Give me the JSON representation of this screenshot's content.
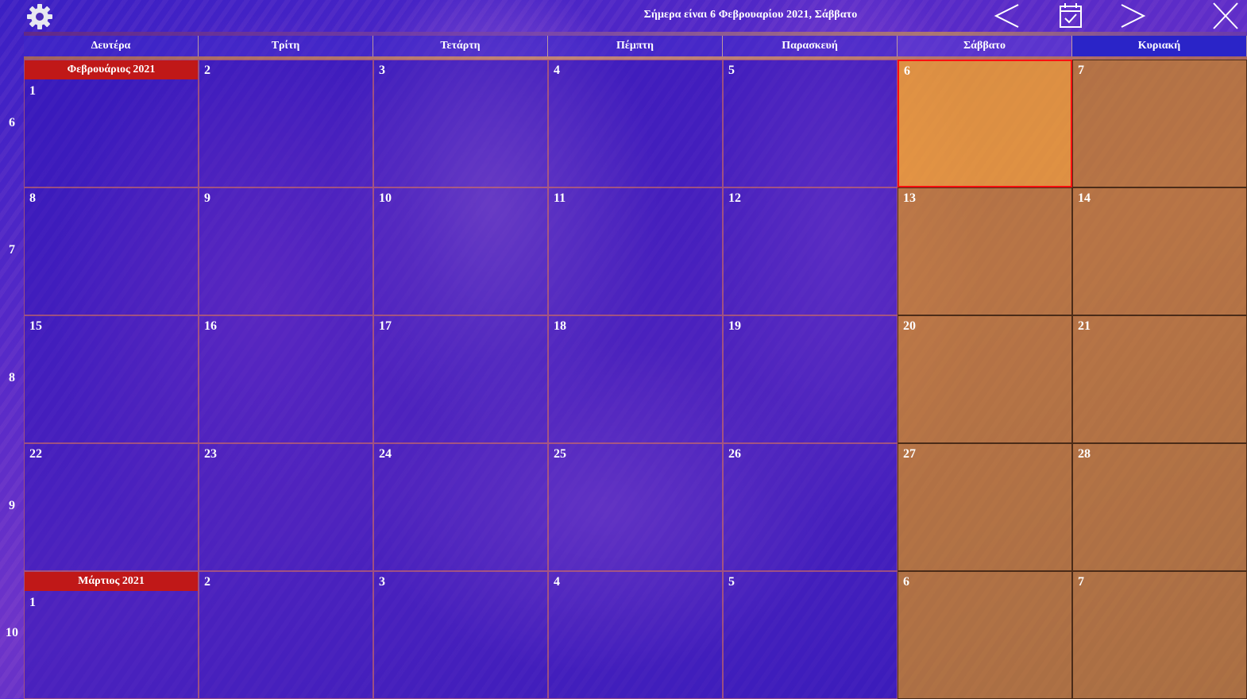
{
  "header": {
    "title": "Σήμερα είναι 6 Φεβρουαρίου 2021, Σάββατο"
  },
  "toolbar": {
    "settings_icon": "gear-icon",
    "prev_icon": "chevron-left-icon",
    "today_icon": "calendar-check-icon",
    "next_icon": "chevron-right-icon",
    "close_icon": "close-icon"
  },
  "weekdays": [
    "Δευτέρα",
    "Τρίτη",
    "Τετάρτη",
    "Πέμπτη",
    "Παρασκευή",
    "Σάββατο",
    "Κυριακή"
  ],
  "weeks": [
    {
      "number": "6",
      "days": [
        "1",
        "2",
        "3",
        "4",
        "5",
        "6",
        "7"
      ]
    },
    {
      "number": "7",
      "days": [
        "8",
        "9",
        "10",
        "11",
        "12",
        "13",
        "14"
      ]
    },
    {
      "number": "8",
      "days": [
        "15",
        "16",
        "17",
        "18",
        "19",
        "20",
        "21"
      ]
    },
    {
      "number": "9",
      "days": [
        "22",
        "23",
        "24",
        "25",
        "26",
        "27",
        "28"
      ]
    },
    {
      "number": "10",
      "days": [
        "1",
        "2",
        "3",
        "4",
        "5",
        "6",
        "7"
      ]
    }
  ],
  "month_labels": {
    "feb": "Φεβρουάριος 2021",
    "mar": "Μάρτιος 2021"
  },
  "colors": {
    "weekday_tint": "#3214b4",
    "weekend_tint": "#d28c14",
    "today_border": "#ff1010",
    "month_label_bg": "#c01818"
  }
}
